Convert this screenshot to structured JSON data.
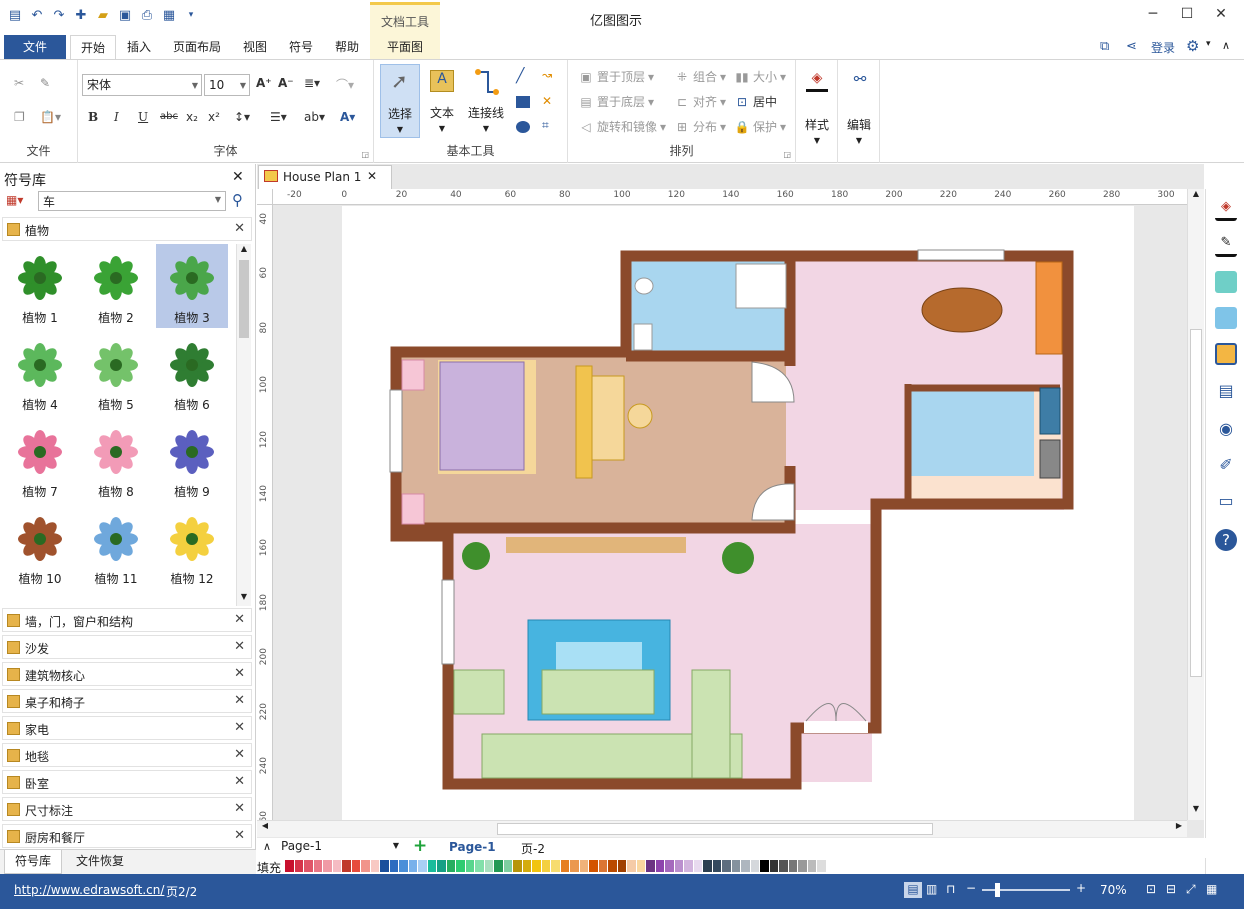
{
  "app": {
    "title": "亿图图示",
    "context_tab_group": "文档工具",
    "login": "登录"
  },
  "tabs": [
    "文件",
    "开始",
    "插入",
    "页面布局",
    "视图",
    "符号",
    "帮助",
    "平面图"
  ],
  "active_tab": "开始",
  "ribbon": {
    "file_group": {
      "label": "文件"
    },
    "font_group": {
      "label": "字体",
      "font_name": "宋体",
      "font_size": "10",
      "bold": "B",
      "italic": "I",
      "underline": "U",
      "strike": "abc"
    },
    "basic_tools": {
      "label": "基本工具",
      "select": "选择",
      "text": "文本",
      "connector": "连接线"
    },
    "arrange": {
      "label": "排列",
      "bring_front": "置于顶层",
      "send_back": "置于底层",
      "rotate": "旋转和镜像",
      "group": "组合",
      "align": "对齐",
      "distribute": "分布",
      "size": "大小",
      "center": "居中",
      "protect": "保护"
    },
    "style": {
      "label": "样式"
    },
    "edit": {
      "label": "编辑"
    }
  },
  "panel": {
    "title": "符号库",
    "search_value": "车",
    "open_category": "植物",
    "plants": [
      "植物 1",
      "植物 2",
      "植物 3",
      "植物 4",
      "植物 5",
      "植物 6",
      "植物 7",
      "植物 8",
      "植物 9",
      "植物 10",
      "植物 11",
      "植物 12"
    ],
    "selected_plant": "植物 3",
    "categories": [
      "墙，门，窗户和结构",
      "沙发",
      "建筑物核心",
      "桌子和椅子",
      "家电",
      "地毯",
      "卧室",
      "尺寸标注",
      "厨房和餐厅"
    ],
    "bottom_tabs": [
      "符号库",
      "文件恢复"
    ]
  },
  "document": {
    "tab_title": "House Plan 1",
    "h_ruler": [
      "-20",
      "0",
      "20",
      "40",
      "60",
      "80",
      "100",
      "120",
      "140",
      "160",
      "180",
      "200",
      "220",
      "240",
      "260",
      "280",
      "300"
    ],
    "v_ruler": [
      "40",
      "60",
      "80",
      "100",
      "120",
      "140",
      "160",
      "180",
      "200",
      "220",
      "240",
      "260"
    ]
  },
  "pages": {
    "selector": "Page-1",
    "active": "Page-1",
    "other": "页-2"
  },
  "fill_label": "填充",
  "palette": [
    "#c8102e",
    "#d6334a",
    "#e05468",
    "#e97686",
    "#f09aa5",
    "#f5bcc3",
    "#c0392b",
    "#e74c3c",
    "#f1948a",
    "#f8c9c3",
    "#1b4f9c",
    "#2d6cc0",
    "#4a8fd9",
    "#78b1eb",
    "#a9cff5",
    "#1abc9c",
    "#16a085",
    "#27ae60",
    "#2ecc71",
    "#58d68d",
    "#82e0aa",
    "#a9dfbf",
    "#229954",
    "#7dcea0",
    "#b7950b",
    "#d4ac0d",
    "#f1c40f",
    "#f4d03f",
    "#f7dc6f",
    "#e67e22",
    "#eb984e",
    "#f0b27a",
    "#d35400",
    "#dc7633",
    "#ba4a00",
    "#a04000",
    "#f5cba7",
    "#fad7a0",
    "#6c3483",
    "#8e44ad",
    "#a569bd",
    "#bb8fce",
    "#d2b4de",
    "#e8daef",
    "#2c3e50",
    "#34495e",
    "#5d6d7e",
    "#85929e",
    "#aeb6bf",
    "#d5d8dc",
    "#000000",
    "#333333",
    "#555555",
    "#777777",
    "#999999",
    "#bbbbbb",
    "#dddddd",
    "#ffffff"
  ],
  "status": {
    "url": "http://www.edrawsoft.cn/",
    "page_info": "页2/2",
    "zoom": "70%"
  },
  "zoom_level": 0.7
}
